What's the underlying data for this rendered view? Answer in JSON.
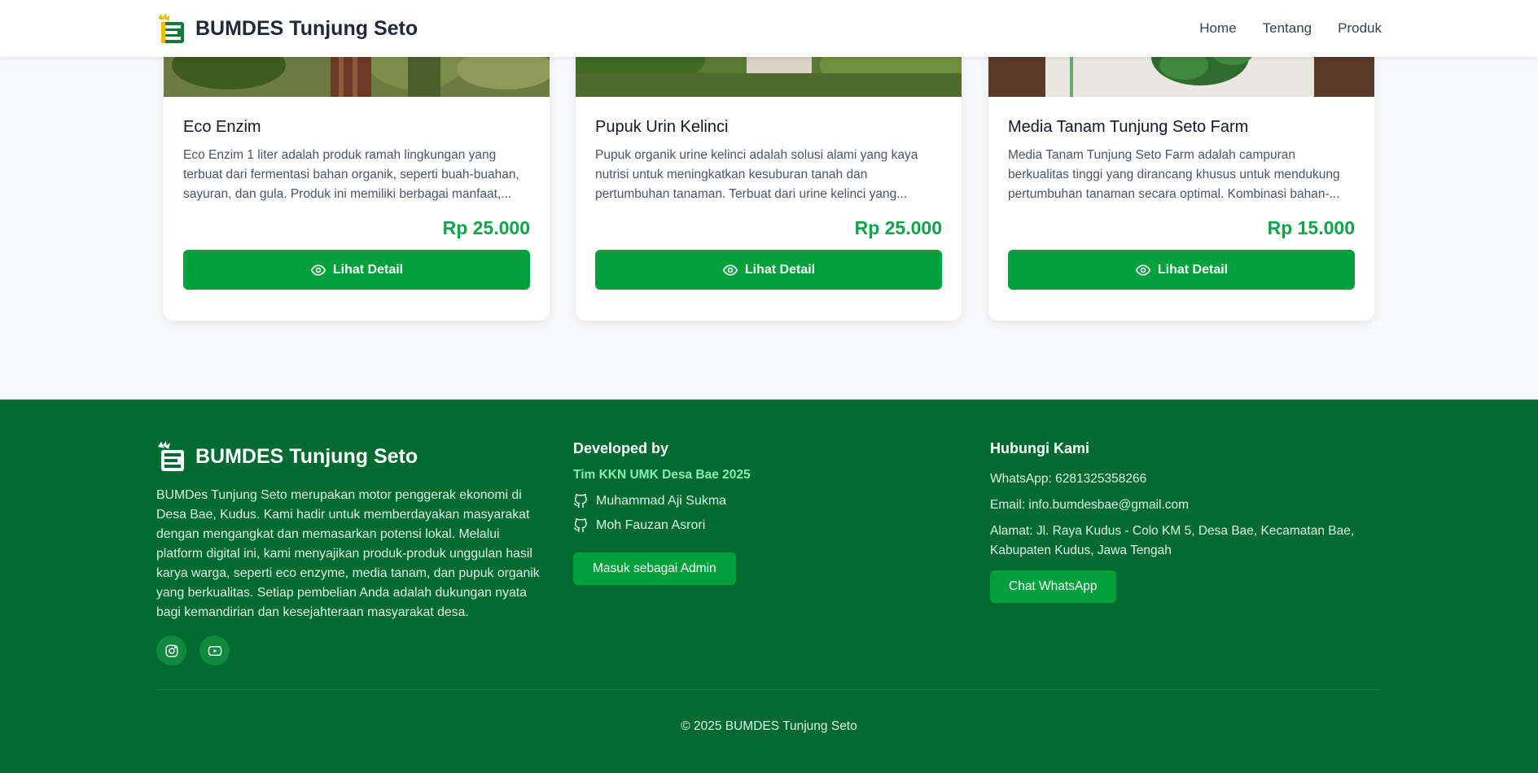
{
  "header": {
    "brand": "BUMDES Tunjung Seto",
    "nav": [
      "Home",
      "Tentang",
      "Produk"
    ]
  },
  "products": [
    {
      "title": "Eco Enzim",
      "description": "Eco Enzim 1 liter adalah produk ramah lingkungan yang terbuat dari fermentasi bahan organik, seperti buah-buahan, sayuran, dan gula. Produk ini memiliki berbagai manfaat,...",
      "price": "Rp 25.000",
      "button": "Lihat Detail"
    },
    {
      "title": "Pupuk Urin Kelinci",
      "description": "Pupuk organik urine kelinci adalah solusi alami yang kaya nutrisi untuk meningkatkan kesuburan tanah dan pertumbuhan tanaman. Terbuat dari urine kelinci yang...",
      "price": "Rp 25.000",
      "button": "Lihat Detail"
    },
    {
      "title": "Media Tanam Tunjung Seto Farm",
      "description": "Media Tanam Tunjung Seto Farm adalah campuran berkualitas tinggi yang dirancang khusus untuk mendukung pertumbuhan tanaman secara optimal. Kombinasi bahan-...",
      "price": "Rp 15.000",
      "button": "Lihat Detail"
    }
  ],
  "footer": {
    "brand": "BUMDES Tunjung Seto",
    "about": "BUMDes Tunjung Seto merupakan motor penggerak ekonomi di Desa Bae, Kudus. Kami hadir untuk memberdayakan masyarakat dengan mengangkat dan memasarkan potensi lokal. Melalui platform digital ini, kami menyajikan produk-produk unggulan hasil karya warga, seperti eco enzyme, media tanam, dan pupuk organik yang berkualitas. Setiap pembelian Anda adalah dukungan nyata bagi kemandirian dan kesejahteraan masyarakat desa.",
    "developed_heading": "Developed by",
    "team": "Tim KKN UMK Desa Bae 2025",
    "developers": [
      "Muhammad Aji Sukma",
      "Moh Fauzan Asrori"
    ],
    "admin_button": "Masuk sebagai Admin",
    "contact_heading": "Hubungi Kami",
    "whatsapp": "WhatsApp: 6281325358266",
    "email": "Email: info.bumdesbae@gmail.com",
    "address": "Alamat: Jl. Raya Kudus - Colo KM 5, Desa Bae, Kecamatan Bae, Kabupaten Kudus, Jawa Tengah",
    "wa_button": "Chat WhatsApp",
    "copyright": "© 2025 BUMDES Tunjung Seto"
  },
  "colors": {
    "primary_green": "#00a03c",
    "footer_bg": "#006b31",
    "price_green": "#0ea44a",
    "team_green": "#86efac"
  },
  "icons": [
    "logo-icon",
    "eye-icon",
    "instagram-icon",
    "youtube-icon",
    "github-icon"
  ]
}
